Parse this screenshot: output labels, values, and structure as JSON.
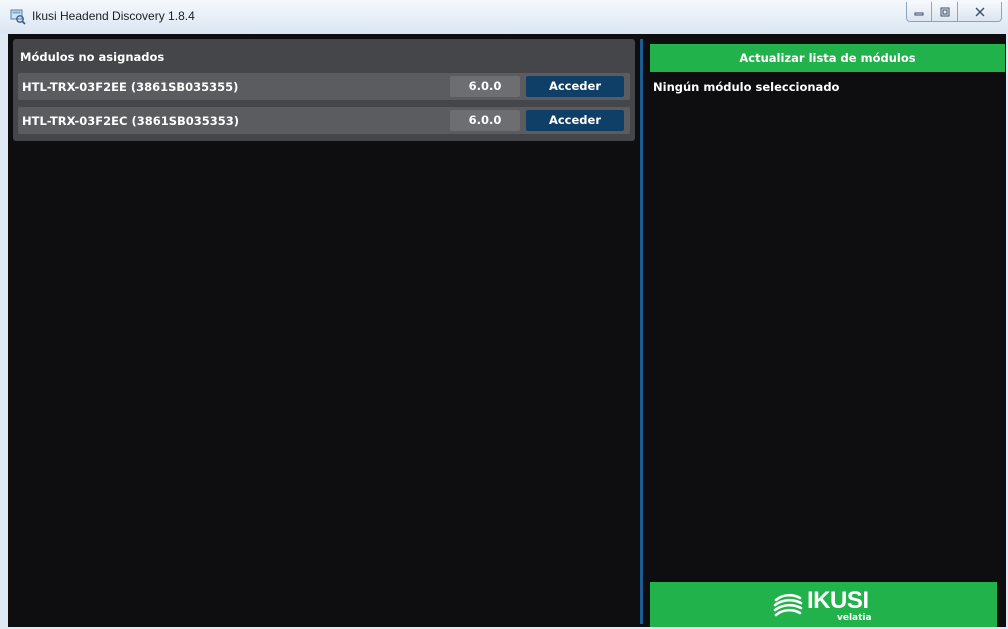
{
  "window": {
    "title": "Ikusi Headend Discovery 1.8.4",
    "icon": "magnifier-app-icon"
  },
  "modules_panel": {
    "title": "Módulos no asignados",
    "rows": [
      {
        "name": "HTL-TRX-03F2EE (3861SB035355)",
        "version": "6.0.0",
        "action_label": "Acceder"
      },
      {
        "name": "HTL-TRX-03F2EC (3861SB035353)",
        "version": "6.0.0",
        "action_label": "Acceder"
      }
    ]
  },
  "details_panel": {
    "refresh_label": "Actualizar lista de módulos",
    "status_text": "Ningún módulo seleccionado"
  },
  "logo": {
    "brand": "IKUSI",
    "sub": "velatia"
  },
  "colors": {
    "accent_green": "#22b24c",
    "button_blue": "#0f3f66",
    "splitter_blue": "#1b5b93",
    "background": "#0e0d0f"
  }
}
